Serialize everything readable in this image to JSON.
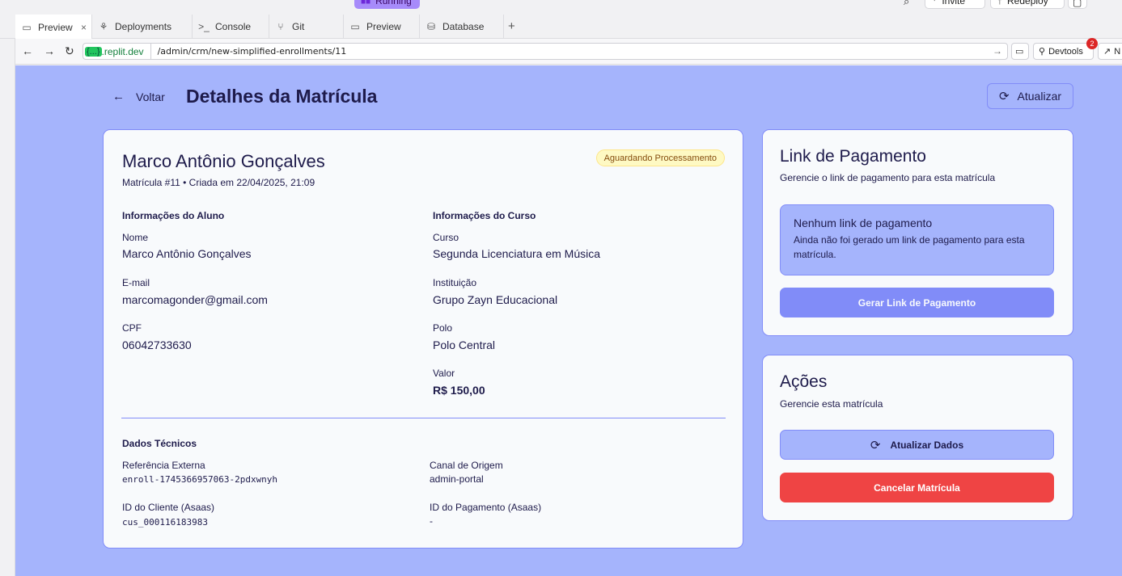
{
  "topbar": {
    "run_status": "Running",
    "invite_label": "Invite",
    "deploy_label": "Redeploy"
  },
  "tabs": [
    {
      "label": "Preview",
      "icon": "monitor-icon"
    },
    {
      "label": "Deployments",
      "icon": "deploy-icon"
    },
    {
      "label": "Console",
      "icon": "terminal-icon"
    },
    {
      "label": "Git",
      "icon": "git-icon"
    },
    {
      "label": "Preview",
      "icon": "monitor-icon"
    },
    {
      "label": "Database",
      "icon": "database-icon"
    }
  ],
  "urlbar": {
    "host_badge": "{...}",
    "host": ".replit.dev",
    "path": "/admin/crm/new-simplified-enrollments/11",
    "devtools_label": "Devtools",
    "devtools_count": "2",
    "newtab_label": "N"
  },
  "header": {
    "back_label": "Voltar",
    "title": "Detalhes da Matrícula",
    "refresh_label": "Atualizar"
  },
  "enrollment": {
    "student_name": "Marco Antônio Gonçalves",
    "meta": "Matrícula #11 • Criada em 22/04/2025, 21:09",
    "status": "Aguardando Processamento",
    "student_section": "Informações do Aluno",
    "course_section": "Informações do Curso",
    "fields": {
      "name_label": "Nome",
      "name_value": "Marco Antônio Gonçalves",
      "email_label": "E-mail",
      "email_value": "marcomagonder@gmail.com",
      "cpf_label": "CPF",
      "cpf_value": "06042733630",
      "course_label": "Curso",
      "course_value": "Segunda Licenciatura em Música",
      "institution_label": "Instituição",
      "institution_value": "Grupo Zayn Educacional",
      "polo_label": "Polo",
      "polo_value": "Polo Central",
      "price_label": "Valor",
      "price_value": "R$ 150,00"
    },
    "tech_section": "Dados Técnicos",
    "tech": {
      "ext_ref_label": "Referência Externa",
      "ext_ref_value": "enroll-1745366957063-2pdxwnyh",
      "channel_label": "Canal de Origem",
      "channel_value": "admin-portal",
      "client_id_label": "ID do Cliente (Asaas)",
      "client_id_value": "cus_000116183983",
      "payment_id_label": "ID do Pagamento (Asaas)",
      "payment_id_value": "-"
    }
  },
  "payment_card": {
    "title": "Link de Pagamento",
    "subtitle": "Gerencie o link de pagamento para esta matrícula",
    "empty_title": "Nenhum link de pagamento",
    "empty_text": "Ainda não foi gerado um link de pagamento para esta matrícula.",
    "generate_label": "Gerar Link de Pagamento"
  },
  "actions_card": {
    "title": "Ações",
    "subtitle": "Gerencie esta matrícula",
    "update_label": "Atualizar Dados",
    "cancel_label": "Cancelar Matrícula"
  },
  "colors": {
    "app_bg": "#a5b4fc",
    "accent": "#818cf8",
    "danger": "#ef4444",
    "text": "#1e1b4b"
  }
}
